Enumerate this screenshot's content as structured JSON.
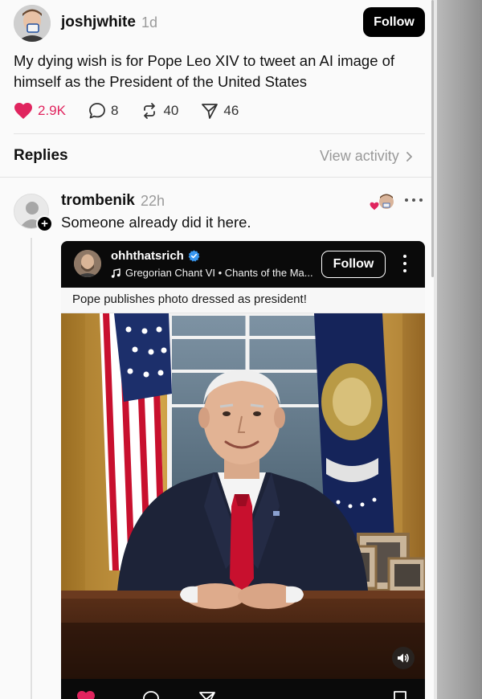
{
  "post": {
    "username": "joshjwhite",
    "time": "1d",
    "follow_label": "Follow",
    "text": "My dying wish is for Pope Leo XIV to tweet an AI image of himself as the President of the United States",
    "likes": "2.9K",
    "comments": "8",
    "reposts": "40",
    "shares": "46"
  },
  "replies_section": {
    "label": "Replies",
    "view_activity": "View activity"
  },
  "reply": {
    "username": "trombenik",
    "time": "22h",
    "text": "Someone already did it here.",
    "plus_badge": "+"
  },
  "embed": {
    "username": "ohhthatsrich",
    "song": "Gregorian Chant VI • Chants of the Ma...",
    "follow_label": "Follow",
    "caption": "Pope publishes photo dressed as president!"
  },
  "colors": {
    "like_red": "#e0245e",
    "follow_bg": "#000000",
    "verified_blue": "#3897f0",
    "tie_red": "#c8102e",
    "curtain_gold": "#c89a3c"
  },
  "icons": {
    "like": "heart-filled-icon",
    "comment": "speech-bubble-icon",
    "repost": "repost-arrows-icon",
    "share": "send-triangle-icon",
    "chevron": "chevron-right-icon",
    "more": "more-horizontal-icon",
    "music": "music-note-icon",
    "verified": "verified-badge-icon",
    "volume": "speaker-icon"
  }
}
